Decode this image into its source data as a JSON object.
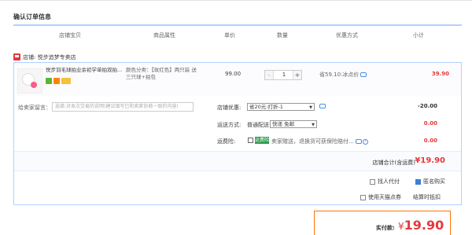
{
  "page": {
    "section_title": "确认订单信息"
  },
  "table_head": {
    "col_item": "店铺宝贝",
    "col_attr": "商品属性",
    "col_price": "单价",
    "col_qty": "数量",
    "col_promo": "优惠方式",
    "col_subtotal": "小计"
  },
  "shop": {
    "label": "店铺: 悦步追梦专卖店"
  },
  "item": {
    "title": "悦步羽毛球拍业余初学单拍双拍...",
    "attrs": "颜色分类：【玫红色】两只装 送三只球+拍包",
    "price": "99.00",
    "qty": "1",
    "qty_minus": "-",
    "qty_plus": "+",
    "promo": "省59.10:冰点价",
    "subtotal": "39.90"
  },
  "message": {
    "label": "给卖家留言：",
    "placeholder": "选填:对本次交易的说明(建议填写已和卖家协商一致的内容)"
  },
  "shop_promo": {
    "label": "店铺优惠:",
    "select_value": "省20元:打折-1",
    "amount": "-20.00"
  },
  "shipping": {
    "label": "运送方式:",
    "normal": "普通配送",
    "select_value": "快递 免邮",
    "amount": "0.00"
  },
  "insurance": {
    "label": "运费险:",
    "badge": "运费险",
    "text": "卖家赠送，退换货可获保险赔付...",
    "qmark": "?",
    "amount": "0.00"
  },
  "shop_total": {
    "label": "店铺合计(含运费)",
    "value": "¥19.90"
  },
  "options": {
    "proxy_pay": "找人代付",
    "anonymous": "匿名购买",
    "tmall_points": "使用天猫点券",
    "points_rule": "结算时抵扣"
  },
  "payment": {
    "label": "实付款:",
    "currency": "¥",
    "value": "19.90"
  },
  "colors": {
    "accent": "#e4393c",
    "border_blue": "#b2d1ff",
    "pay_border": "#ff7200",
    "insurance_green": "#2c9b4c"
  }
}
